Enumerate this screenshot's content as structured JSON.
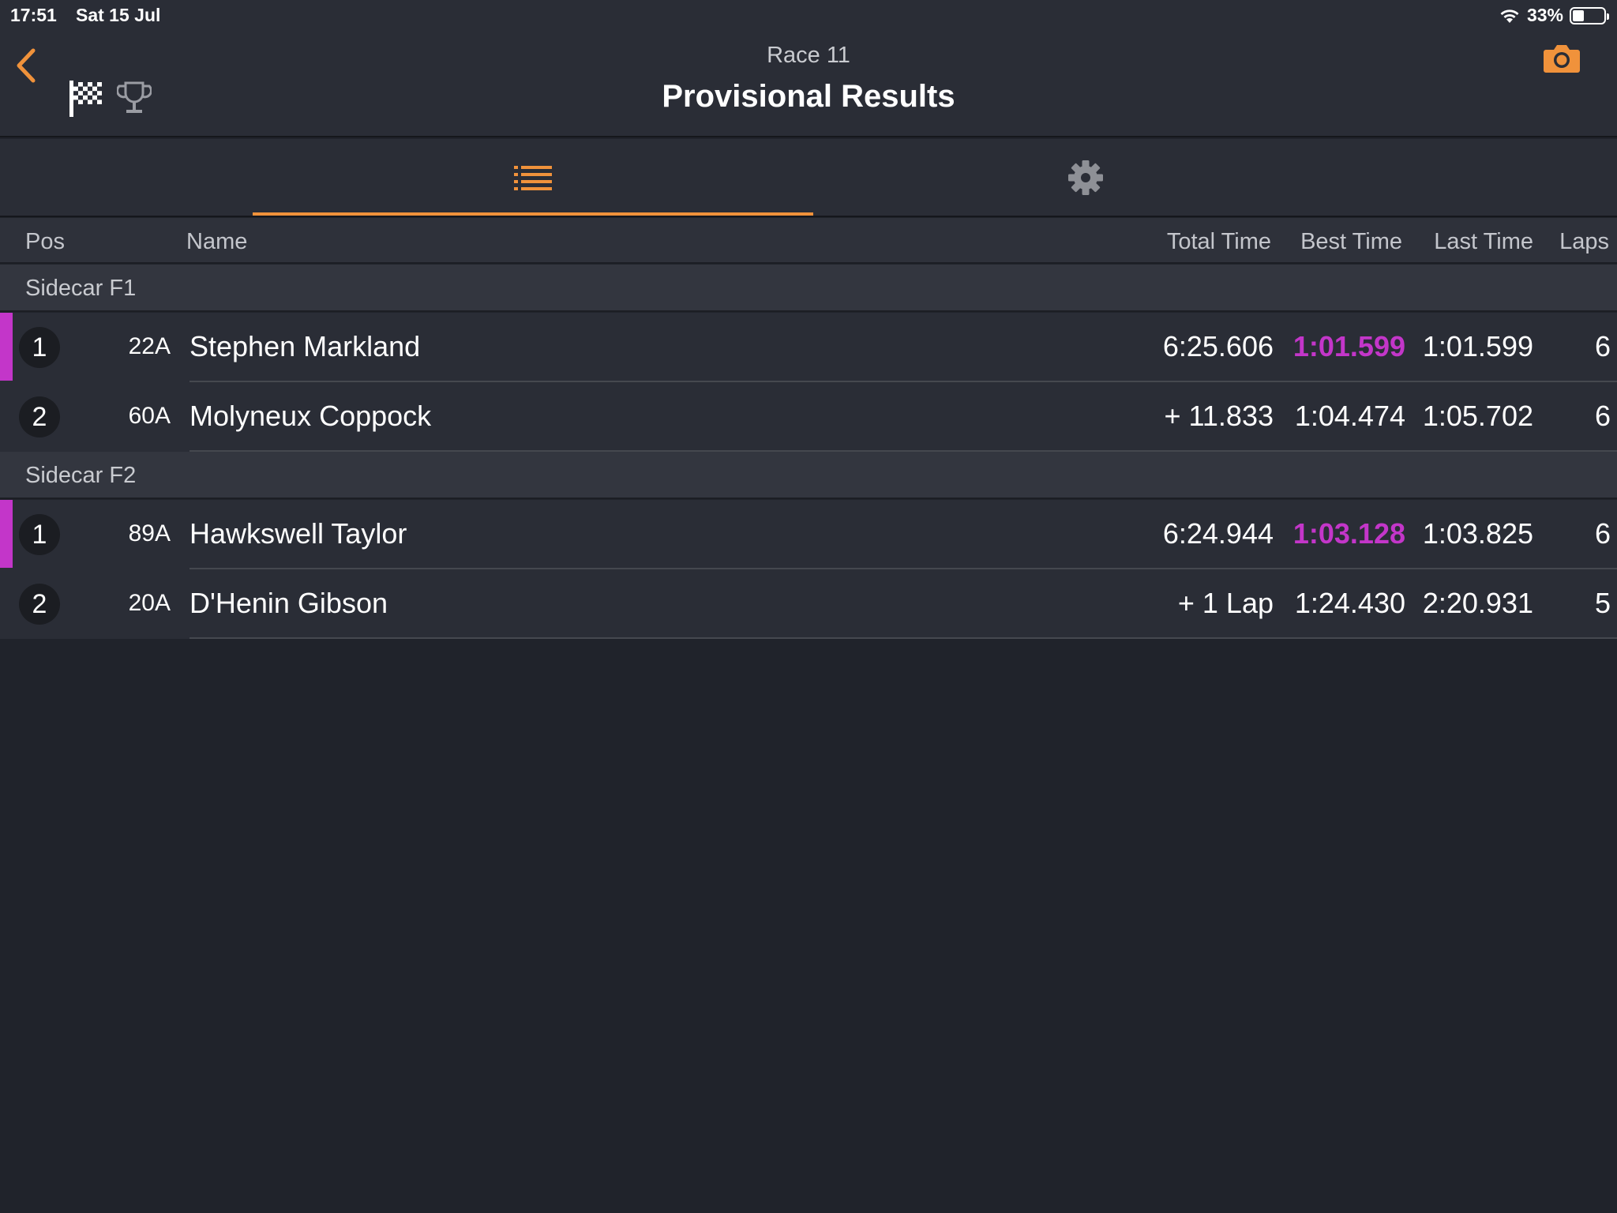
{
  "status": {
    "time": "17:51",
    "date": "Sat 15 Jul",
    "battery": "33%",
    "battery_level": 0.33
  },
  "header": {
    "subtitle": "Race 11",
    "title": "Provisional Results"
  },
  "table": {
    "columns": {
      "pos": "Pos",
      "name": "Name",
      "total": "Total Time",
      "best": "Best Time",
      "last": "Last Time",
      "laps": "Laps"
    }
  },
  "groups": [
    {
      "name": "Sidecar F1",
      "rows": [
        {
          "pos": "1",
          "bib": "22A",
          "name": "Stephen Markland",
          "total": "6:25.606",
          "best": "1:01.599",
          "last": "1:01.599",
          "laps": "6",
          "leader": true,
          "best_highlight": true
        },
        {
          "pos": "2",
          "bib": "60A",
          "name": "Molyneux Coppock",
          "total": "+ 11.833",
          "best": "1:04.474",
          "last": "1:05.702",
          "laps": "6",
          "leader": false,
          "best_highlight": false
        }
      ]
    },
    {
      "name": "Sidecar F2",
      "rows": [
        {
          "pos": "1",
          "bib": "89A",
          "name": "Hawkswell Taylor",
          "total": "6:24.944",
          "best": "1:03.128",
          "last": "1:03.825",
          "laps": "6",
          "leader": true,
          "best_highlight": true
        },
        {
          "pos": "2",
          "bib": "20A",
          "name": "D'Henin Gibson",
          "total": "+ 1 Lap",
          "best": "1:24.430",
          "last": "2:20.931",
          "laps": "5",
          "leader": false,
          "best_highlight": false
        }
      ]
    }
  ],
  "colors": {
    "accent": "#f0923b",
    "highlight": "#c336c9",
    "background": "#20232b"
  },
  "icons": {
    "back": "chevron-left-icon",
    "flag": "checkered-flag-icon",
    "trophy": "trophy-icon",
    "camera": "camera-icon",
    "list": "list-icon",
    "settings": "gear-icon"
  }
}
